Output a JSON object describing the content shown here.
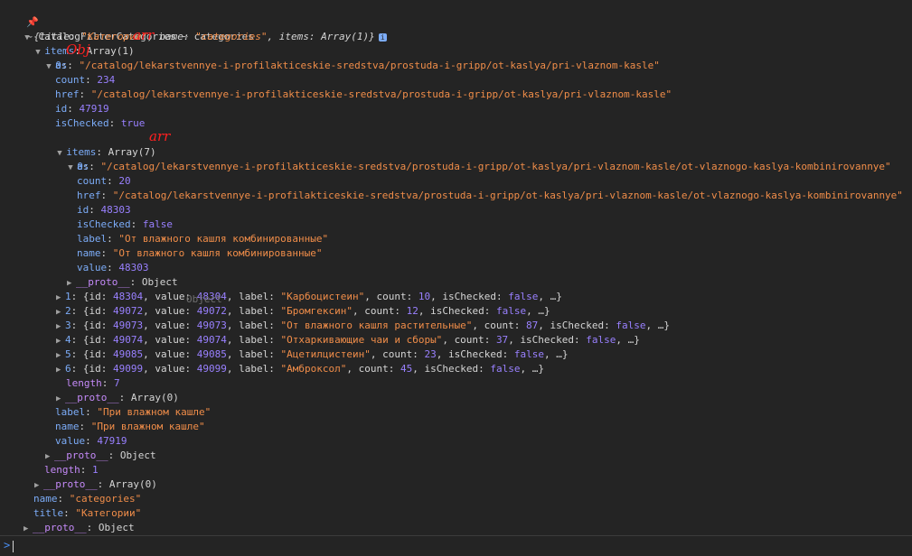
{
  "header": {
    "pin_icon": "pin-icon",
    "text": "~ CatalogFilterCategories ~ categories"
  },
  "root": {
    "preview_open": "{title: ",
    "preview_title_val": "\"Категории\"",
    "preview_mid1": ", name: ",
    "preview_name_val": "\"categories\"",
    "preview_mid2": ", items: ",
    "preview_items_val": "Array(1)",
    "preview_close": "}",
    "info_glyph": "i"
  },
  "items_key": "items",
  "items_type": "Array(1)",
  "item0_key": "0",
  "item0": {
    "as_key": "as",
    "as_val": "\"/catalog/lekarstvennye-i-profilakticeskie-sredstva/prostuda-i-gripp/ot-kaslya/pri-vlaznom-kasle\"",
    "count_key": "count",
    "count_val": "234",
    "href_key": "href",
    "href_val": "\"/catalog/lekarstvennye-i-profilakticeskie-sredstva/prostuda-i-gripp/ot-kaslya/pri-vlaznom-kasle\"",
    "id_key": "id",
    "id_val": "47919",
    "isChecked_key": "isChecked",
    "isChecked_val": "true",
    "items_key": "items",
    "items_type": "Array(7)",
    "label_key": "label",
    "label_val": "\"При влажном кашле\"",
    "name_key": "name",
    "name_val": "\"При влажном кашле\"",
    "value_key": "value",
    "value_val": "47919",
    "proto_key": "__proto__",
    "proto_val": "Object"
  },
  "sub0": {
    "key": "0",
    "as_key": "as",
    "as_val": "\"/catalog/lekarstvennye-i-profilakticeskie-sredstva/prostuda-i-gripp/ot-kaslya/pri-vlaznom-kasle/ot-vlaznogo-kaslya-kombinirovannye\"",
    "count_key": "count",
    "count_val": "20",
    "href_key": "href",
    "href_val": "\"/catalog/lekarstvennye-i-profilakticeskie-sredstva/prostuda-i-gripp/ot-kaslya/pri-vlaznom-kasle/ot-vlaznogo-kaslya-kombinirovannye\"",
    "id_key": "id",
    "id_val": "48303",
    "isChecked_key": "isChecked",
    "isChecked_val": "false",
    "label_key": "label",
    "label_val": "\"От влажного кашля комбинированные\"",
    "name_key": "name",
    "name_val": "\"От влажного кашля комбинированные\"",
    "value_key": "value",
    "value_val": "48303",
    "proto_key": "__proto__",
    "proto_val": "Object"
  },
  "sub_items": [
    {
      "idx": "1",
      "id": "48304",
      "value": "48304",
      "label": "\"Карбоцистеин\"",
      "count": "10",
      "isChecked": "false"
    },
    {
      "idx": "2",
      "id": "49072",
      "value": "49072",
      "label": "\"Бромгексин\"",
      "count": "12",
      "isChecked": "false"
    },
    {
      "idx": "3",
      "id": "49073",
      "value": "49073",
      "label": "\"От влажного кашля растительные\"",
      "count": "87",
      "isChecked": "false"
    },
    {
      "idx": "4",
      "id": "49074",
      "value": "49074",
      "label": "\"Отхаркивающие чаи и сборы\"",
      "count": "37",
      "isChecked": "false"
    },
    {
      "idx": "5",
      "id": "49085",
      "value": "49085",
      "label": "\"Ацетилцистеин\"",
      "count": "23",
      "isChecked": "false"
    },
    {
      "idx": "6",
      "id": "49099",
      "value": "49099",
      "label": "\"Амброксол\"",
      "count": "45",
      "isChecked": "false"
    }
  ],
  "preview_labels": {
    "id": "id",
    "value": "value",
    "label": "label",
    "count": "count",
    "isChecked": "isChecked",
    "ellipsis": "…"
  },
  "sub_length_key": "length",
  "sub_length_val": "7",
  "sub_proto_key": "__proto__",
  "sub_proto_val": "Array(0)",
  "items_length_key": "length",
  "items_length_val": "1",
  "items_proto_key": "__proto__",
  "items_proto_val": "Array(0)",
  "root_name_key": "name",
  "root_name_val": "\"categories\"",
  "root_title_key": "title",
  "root_title_val": "\"Категории\"",
  "root_proto_key": "__proto__",
  "root_proto_val": "Object",
  "annotations": {
    "arr1": "arr",
    "obj": "Obj",
    "arr2": "arr"
  },
  "overlay_text": "Object",
  "prompt": {
    "caret": ">"
  }
}
